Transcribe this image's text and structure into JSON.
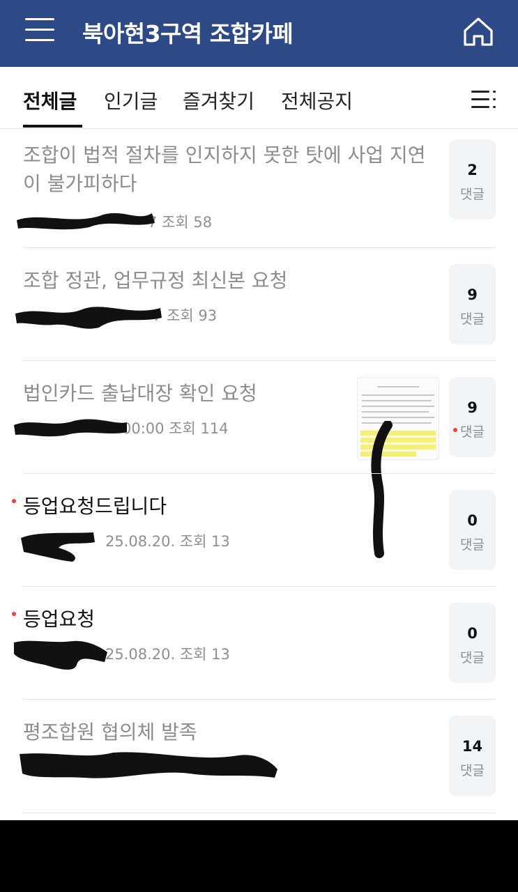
{
  "header": {
    "title": "북아현3구역 조합카페"
  },
  "tabs": [
    {
      "label": "전체글",
      "active": true
    },
    {
      "label": "인기글",
      "active": false
    },
    {
      "label": "즐겨찾기",
      "active": false
    },
    {
      "label": "전체공지",
      "active": false
    }
  ],
  "posts": [
    {
      "title": "조합이 법적 절차를 인지하지 못한 탓에 사업 지연이 불가피하다",
      "meta": "7  조회 58",
      "comments": "2",
      "comment_label": "댓글",
      "read": true,
      "new": false
    },
    {
      "title": "조합 정관, 업무규정 최신본 요청",
      "meta": "7  조회 93",
      "comments": "9",
      "comment_label": "댓글",
      "read": true,
      "new": false
    },
    {
      "title": "법인카드 출납대장 확인 요청",
      "meta": "00:00  조회 114",
      "comments": "9",
      "comment_label": "댓글",
      "read": true,
      "new": false,
      "new_comment": true,
      "has_thumbnail": true
    },
    {
      "title": "등업요청드립니다",
      "meta": "25.08.20.  조회 13",
      "comments": "0",
      "comment_label": "댓글",
      "read": false,
      "new": true
    },
    {
      "title": "등업요청",
      "meta": "25.08.20.  조회 13",
      "comments": "0",
      "comment_label": "댓글",
      "read": false,
      "new": true
    },
    {
      "title": "평조합원 협의체 발족",
      "meta": "",
      "comments": "14",
      "comment_label": "댓글",
      "read": true,
      "new": false
    }
  ],
  "colors": {
    "header_bg": "#2d4a86",
    "new_dot": "#e8453c",
    "comment_box_bg": "#f3f4f6",
    "thumbnail_highlight": "#f4ef7a"
  },
  "icons": {
    "menu": "hamburger-icon",
    "home": "home-icon",
    "more": "list-menu-icon"
  }
}
